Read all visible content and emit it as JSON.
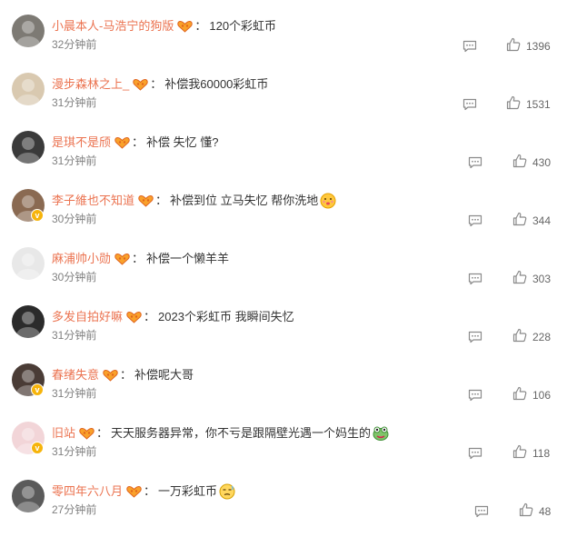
{
  "colors": {
    "username": "#eb7350",
    "text": "#333333",
    "meta": "#808080",
    "badge": "#f6b40b"
  },
  "comments": [
    {
      "username": "小晨本人-马浩宁的狗版",
      "text": "120个彩虹币",
      "time": "32分钟前",
      "likes": "1396",
      "verified": false,
      "emoji": "",
      "avatar": "#7d7a74"
    },
    {
      "username": "漫步森林之上_",
      "text": "补偿我60000彩虹币",
      "time": "31分钟前",
      "likes": "1531",
      "verified": false,
      "emoji": "",
      "avatar": "#d9c9b0"
    },
    {
      "username": "是琪不是颀",
      "text": "补偿 失忆 懂?",
      "time": "31分钟前",
      "likes": "430",
      "verified": false,
      "emoji": "",
      "avatar": "#3a3a3a"
    },
    {
      "username": "李子維也不知道",
      "text": "补偿到位 立马失忆 帮你洗地",
      "time": "30分钟前",
      "likes": "344",
      "verified": true,
      "emoji": "kiss-emoji",
      "avatar": "#8a6a52"
    },
    {
      "username": "麻浦帅小勋",
      "text": "补偿一个懒羊羊",
      "time": "30分钟前",
      "likes": "303",
      "verified": false,
      "emoji": "",
      "avatar": "#e8e8e8"
    },
    {
      "username": "多发自拍好嘛",
      "text": "2023个彩虹币 我瞬间失忆",
      "time": "31分钟前",
      "likes": "228",
      "verified": false,
      "emoji": "",
      "avatar": "#2b2b2b"
    },
    {
      "username": "春绪失意",
      "text": "补偿呢大哥",
      "time": "31分钟前",
      "likes": "106",
      "verified": true,
      "emoji": "",
      "avatar": "#4a3c36"
    },
    {
      "username": "旧站",
      "text": "天天服务器异常，你不亏是跟隔壁光遇一个妈生的",
      "time": "31分钟前",
      "likes": "118",
      "verified": true,
      "emoji": "frog-emoji",
      "avatar": "#f2d5d8"
    },
    {
      "username": "零四年六八月",
      "text": "一万彩虹币",
      "time": "27分钟前",
      "likes": "48",
      "verified": false,
      "emoji": "awkward-smile-emoji",
      "avatar": "#5a5a5a"
    }
  ]
}
